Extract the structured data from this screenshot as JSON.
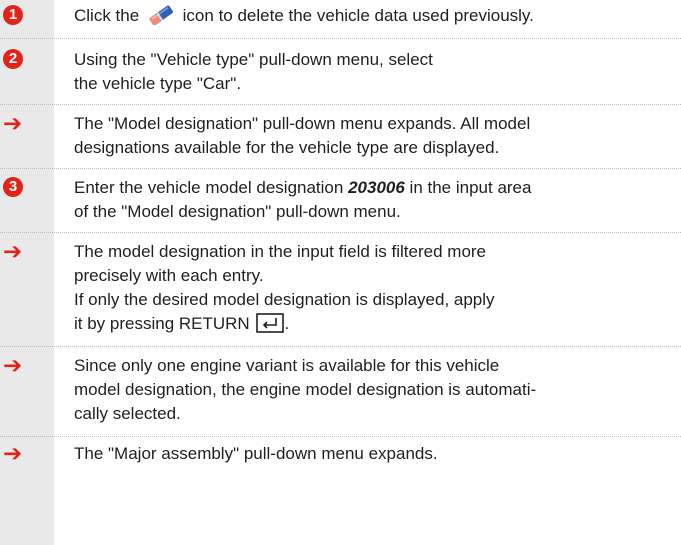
{
  "steps": [
    {
      "marker": "1",
      "parts": [
        "Click the",
        "icon to delete the vehicle data used previously."
      ]
    },
    {
      "marker": "2",
      "lines": [
        "Using the \"Vehicle type\" pull-down menu, select",
        "the vehicle type \"Car\"."
      ]
    },
    {
      "marker": "arrow",
      "lines": [
        "The \"Model designation\" pull-down menu expands. All model",
        "designations available for the vehicle type are displayed."
      ]
    },
    {
      "marker": "3",
      "line1_before": "Enter the vehicle model designation",
      "model_code": "203006",
      "line1_after": "in the input area",
      "line2": "of the \"Model designation\" pull-down menu."
    },
    {
      "marker": "arrow",
      "lines": [
        "The model designation in the input field is filtered more",
        "precisely with each entry.",
        "If only the desired model designation is displayed, apply"
      ],
      "last_line": "it by pressing RETURN"
    },
    {
      "marker": "arrow",
      "lines": [
        "Since only one engine variant is available for this vehicle",
        "model designation, the engine model designation is automati-",
        "cally selected."
      ]
    },
    {
      "marker": "arrow",
      "lines": [
        "The \"Major assembly\" pull-down menu expands."
      ]
    }
  ],
  "icons": {
    "eraser": "eraser-icon",
    "return_key": "return-key-icon",
    "step_marker": "numbered-circle",
    "result_marker": "right-arrow-icon"
  },
  "colors": {
    "accent": "#e2231a",
    "strip": "#e9e9e9",
    "text": "#1f1f1f"
  }
}
